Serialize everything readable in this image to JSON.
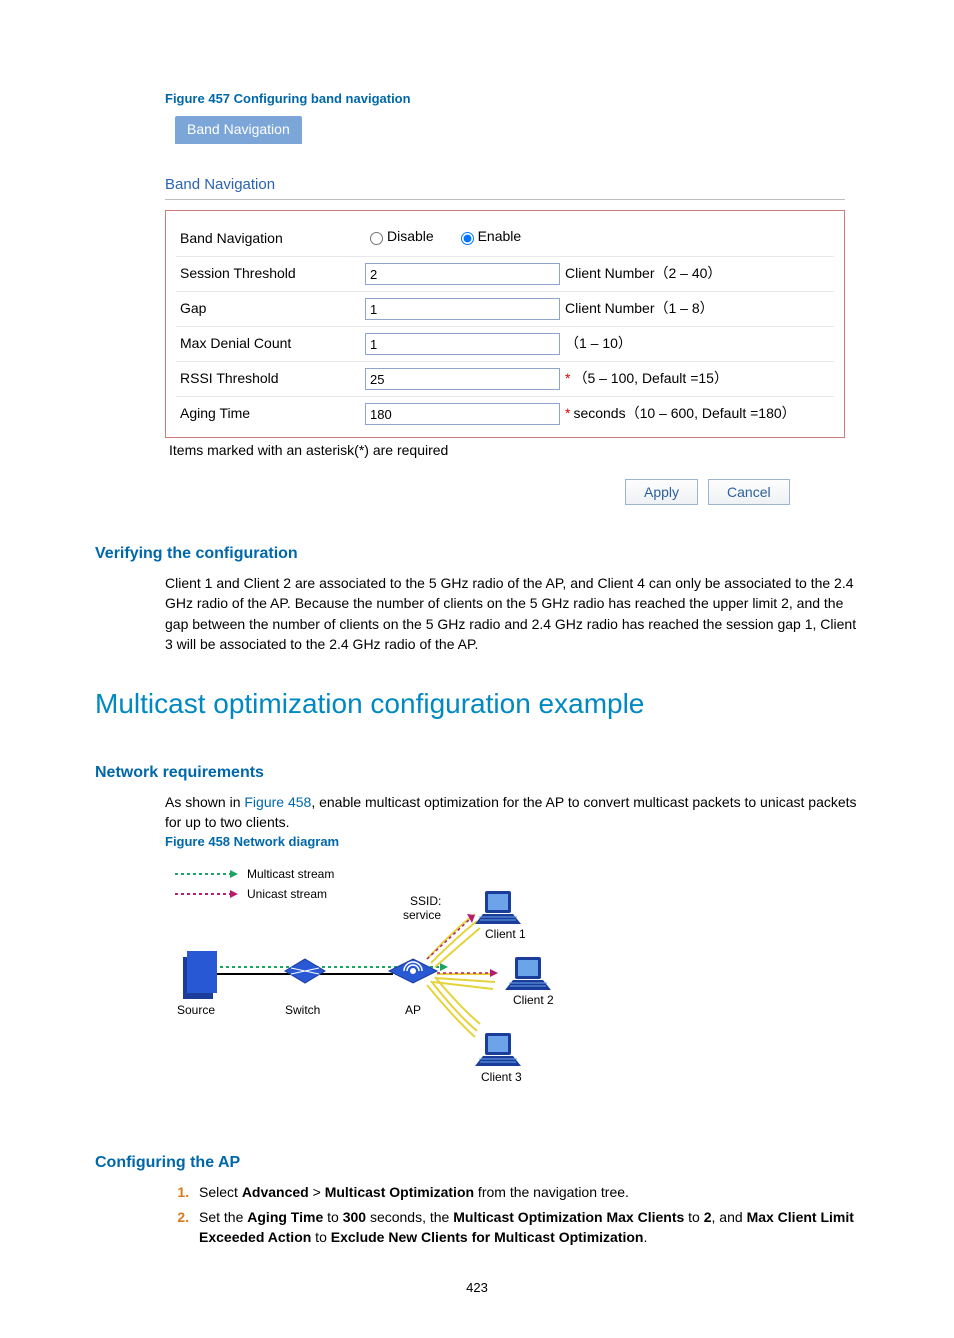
{
  "fig457": {
    "caption": "Figure 457 Configuring band navigation",
    "tab": "Band Navigation",
    "panel_title": "Band Navigation",
    "rows": {
      "band_nav": {
        "label": "Band Navigation",
        "disable": "Disable",
        "enable": "Enable"
      },
      "session": {
        "label": "Session Threshold",
        "value": "2",
        "hint": "Client Number（2 – 40）"
      },
      "gap": {
        "label": "Gap",
        "value": "1",
        "hint": "Client Number（1 – 8）"
      },
      "denial": {
        "label": "Max Denial Count",
        "value": "1",
        "hint": "（1 – 10）"
      },
      "rssi": {
        "label": "RSSI Threshold",
        "value": "25",
        "hint": "（5 – 100, Default =15）"
      },
      "aging": {
        "label": "Aging Time",
        "value": "180",
        "hint": "seconds（10 – 600, Default =180）"
      }
    },
    "footer_note": "Items marked with an asterisk(*) are required",
    "apply": "Apply",
    "cancel": "Cancel"
  },
  "verify": {
    "heading": "Verifying the configuration",
    "body": "Client 1 and Client 2 are associated to the 5 GHz radio of the AP, and Client 4 can only be associated to the 2.4 GHz radio of the AP. Because the number of clients on the 5 GHz radio has reached the upper limit 2, and the gap between the number of clients on the 5 GHz radio and 2.4 GHz radio has reached the session gap 1, Client 3 will be associated to the 2.4 GHz radio of the AP."
  },
  "h1": "Multicast optimization configuration example",
  "netreq": {
    "heading": "Network requirements",
    "text_pre": "As shown in ",
    "xref": "Figure 458",
    "text_post": ", enable multicast optimization for the AP to convert multicast packets to unicast packets for up to two clients."
  },
  "fig458": {
    "caption": "Figure 458 Network diagram",
    "legend_multicast": "Multicast stream",
    "legend_unicast": "Unicast stream",
    "ssid_line1": "SSID:",
    "ssid_line2": "service",
    "source": "Source",
    "switch": "Switch",
    "ap": "AP",
    "client1": "Client 1",
    "client2": "Client 2",
    "client3": "Client 3"
  },
  "conf_ap": {
    "heading": "Configuring the AP",
    "step1": {
      "s1": "Select ",
      "b1": "Advanced",
      "s2": " > ",
      "b2": "Multicast Optimization",
      "s3": " from the navigation tree."
    },
    "step2": {
      "s1": "Set the ",
      "b1": "Aging Time",
      "s2": " to ",
      "b2": "300",
      "s3": " seconds, the ",
      "b3": "Multicast Optimization Max Clients",
      "s4": " to ",
      "b4": "2",
      "s5": ", and ",
      "b5": "Max Client Limit Exceeded Action",
      "s6": " to ",
      "b6": "Exclude New Clients for Multicast Optimization",
      "s7": "."
    }
  },
  "page_number": "423"
}
